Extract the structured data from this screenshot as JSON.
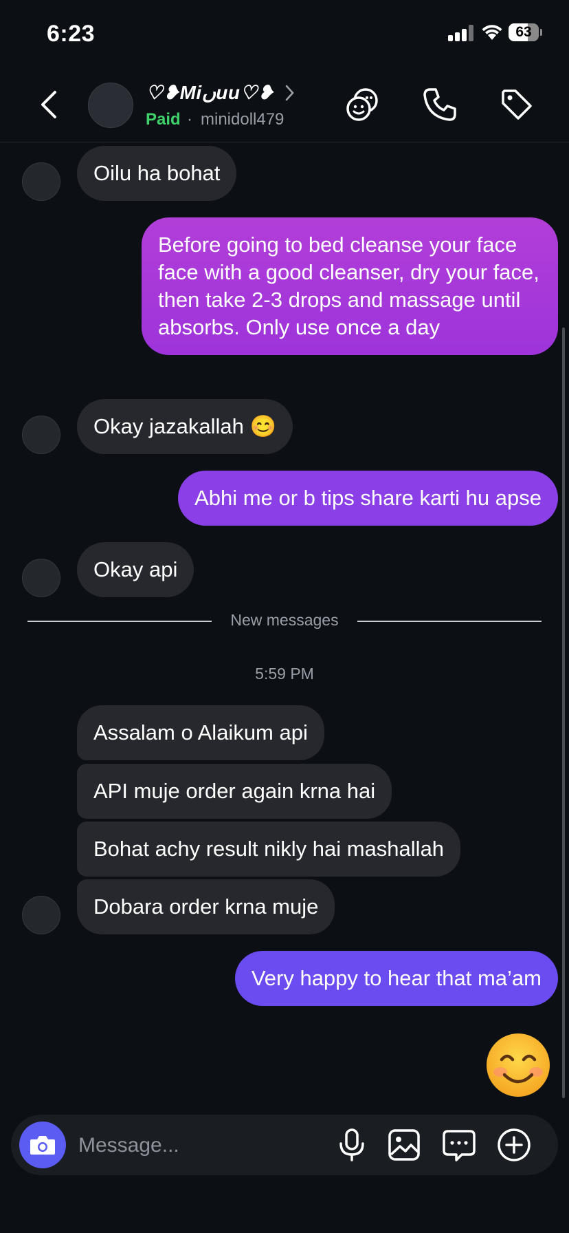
{
  "status_bar": {
    "time": "6:23",
    "battery_percent": "63",
    "battery_level": 0.63
  },
  "header": {
    "contact_name": "♡❥Miںuu♡❥",
    "paid_label": "Paid",
    "separator": "·",
    "username": "minidoll479",
    "icons": [
      "back-chevron-icon",
      "chevron-right-icon",
      "sticker-faces-icon",
      "phone-icon",
      "tag-icon"
    ]
  },
  "messages": [
    {
      "from": "them",
      "text": "Oilu ha bohat"
    },
    {
      "from": "me",
      "text": "Before going to bed cleanse your face face with a good cleanser, dry your face, then take 2-3 drops and massage until absorbs. Only use once a day"
    },
    {
      "from": "them",
      "text": "Okay jazakallah 😊"
    },
    {
      "from": "me",
      "text": "Abhi me or b tips share karti hu apse"
    },
    {
      "from": "them",
      "text": "Okay api"
    },
    {
      "from": "them",
      "text": "Assalam o Alaikum api"
    },
    {
      "from": "them",
      "text": "API muje order again krna hai"
    },
    {
      "from": "them",
      "text": "Bohat achy result nikly hai mashallah"
    },
    {
      "from": "them",
      "text": "Dobara order krna muje"
    },
    {
      "from": "me",
      "text": "Very happy to hear that ma’am"
    }
  ],
  "divider": {
    "new_messages_label": "New messages"
  },
  "timestamp": "5:59 PM",
  "big_emoji": "smiling-face-emoji",
  "composer": {
    "placeholder": "Message...",
    "icons": [
      "camera-icon",
      "microphone-icon",
      "gallery-icon",
      "sticker-chat-icon",
      "plus-circle-icon"
    ]
  },
  "colors": {
    "background": "#0c0f14",
    "received_bubble": "#26282d",
    "sent_pink": "#a838d8",
    "sent_violet": "#8a40e6",
    "sent_blue": "#6a4cf0",
    "paid_green": "#3fd26b",
    "camera_button": "#5b5cf2"
  }
}
